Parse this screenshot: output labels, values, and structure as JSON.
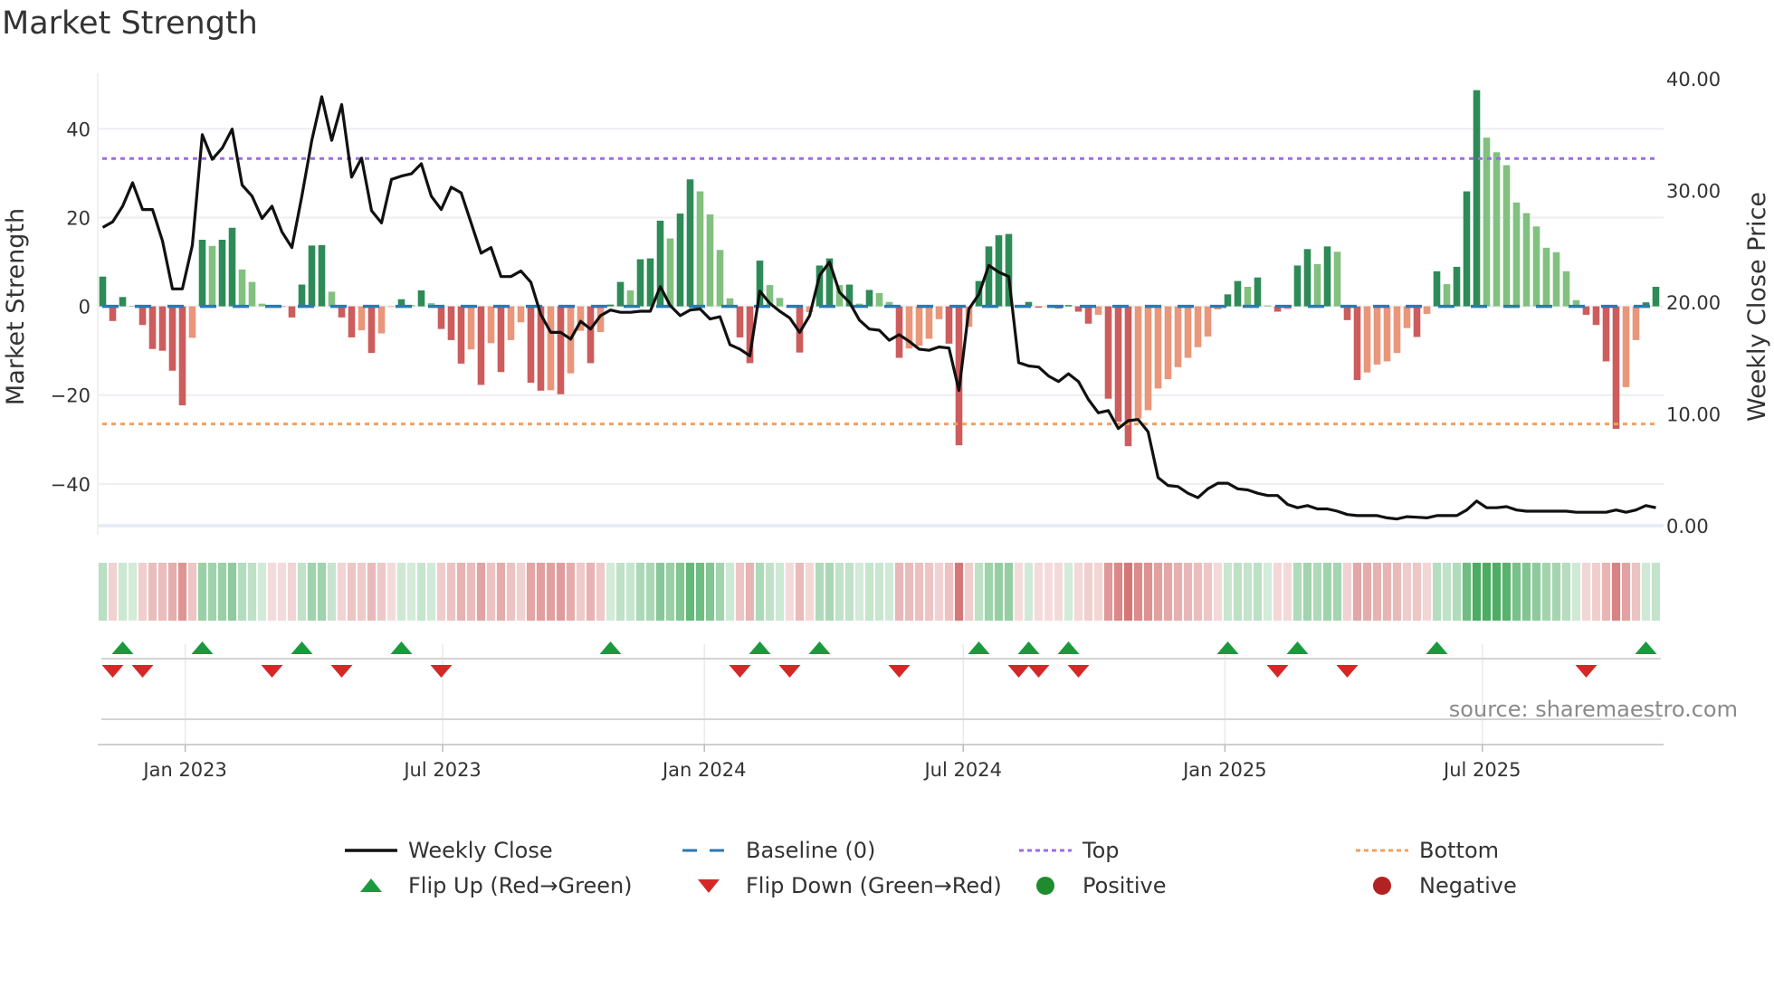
{
  "title": "Market Strength",
  "source": "source: sharemaestro.com",
  "legend": {
    "weekly_close": "Weekly Close",
    "baseline": "Baseline (0)",
    "top": "Top",
    "bottom": "Bottom",
    "flip_up": "Flip Up (Red→Green)",
    "flip_down": "Flip Down (Green→Red)",
    "positive": "Positive",
    "negative": "Negative"
  },
  "colors": {
    "bar_positive_rising": "#2e8b57",
    "bar_positive_falling": "#82c07f",
    "bar_negative_falling": "#cd5c5c",
    "bar_negative_rising": "#e9967a",
    "baseline": "#2a7ab0",
    "top": "#9b6ee0",
    "bottom": "#f2a062",
    "close": "#111111",
    "flip_up": "#1a9a3c",
    "flip_down": "#d62728",
    "positive": "#1e8c2e",
    "negative": "#b22222"
  },
  "chart_data": {
    "type": "bar",
    "title": "Market Strength",
    "ylabel": "Market Strength",
    "y2label": "Weekly Close Price",
    "ylim": [
      -49.4,
      52.5
    ],
    "y2lim": [
      0,
      40.5
    ],
    "yticks": [
      "40",
      "20",
      "0",
      "−20",
      "−40"
    ],
    "ytick_values": [
      40,
      20,
      0,
      -20,
      -40
    ],
    "y2ticks": [
      "40.00",
      "30.00",
      "20.00",
      "10.00",
      "0.00"
    ],
    "y2tick_values": [
      40,
      30,
      20,
      10,
      0
    ],
    "xticks": [
      {
        "label": "Jan 2023",
        "date": "2023-01-01"
      },
      {
        "label": "Jul 2023",
        "date": "2023-07-01"
      },
      {
        "label": "Jan 2024",
        "date": "2024-01-01"
      },
      {
        "label": "Jul 2024",
        "date": "2024-07-01"
      },
      {
        "label": "Jan 2025",
        "date": "2025-01-01"
      },
      {
        "label": "Jul 2025",
        "date": "2025-07-01"
      }
    ],
    "x_start": "2022-11-04",
    "x_frequency": "weekly",
    "grid": true,
    "legend_position": "bottom",
    "top_level": 33.3,
    "bottom_level": -26.5,
    "baseline": 0,
    "strength": [
      6.7,
      -3.3,
      2.1,
      0.1,
      -4.2,
      -9.6,
      -10,
      -14.5,
      -22.3,
      -7.1,
      15,
      13.6,
      15,
      17.7,
      8.3,
      5.5,
      0.6,
      -0.1,
      -0.1,
      -2.5,
      4.9,
      13.7,
      13.8,
      3.3,
      -2.5,
      -7,
      -5.4,
      -10.5,
      -6.1,
      -0.1,
      1.6,
      0.3,
      3.6,
      0.7,
      -5.1,
      -7.6,
      -12.9,
      -9.7,
      -17.7,
      -8.3,
      -14.8,
      -7.6,
      -3.6,
      -17.2,
      -19,
      -18.9,
      -19.8,
      -15.1,
      -5.5,
      -12.8,
      -5.8,
      0.4,
      5.5,
      3.6,
      10.6,
      10.8,
      19.3,
      15.3,
      20.9,
      28.6,
      25.9,
      20.7,
      12.7,
      1.8,
      -7,
      -12.8,
      10.3,
      4.8,
      1.9,
      -0.3,
      -10.4,
      -1.3,
      9.2,
      10.8,
      4.8,
      4.9,
      0.6,
      3.7,
      3.0,
      1.0,
      -11.6,
      -9.5,
      -8.9,
      -7.3,
      -2.9,
      -8.4,
      -31.3,
      -4.6,
      5.7,
      13.5,
      16,
      16.3,
      -0.2,
      1.0,
      -0.3,
      -0.1,
      -0.5,
      0.3,
      -1.2,
      -3.9,
      -1.9,
      -20.8,
      -26.0,
      -31.5,
      -25.3,
      -23.4,
      -18.5,
      -16.4,
      -13.7,
      -11.6,
      -9.2,
      -6.8,
      -0.7,
      2.7,
      5.7,
      4.4,
      6.5,
      0.2,
      -1.2,
      -0.6,
      9.2,
      12.9,
      9.5,
      13.5,
      12.3,
      -3.1,
      -16.6,
      -14.9,
      -13.1,
      -12.4,
      -10.5,
      -4.9,
      -6.9,
      -1.7,
      7.9,
      5.0,
      8.9,
      25.9,
      48.7,
      38,
      34.7,
      31.8,
      23.4,
      21,
      18,
      13.2,
      12.2,
      7.9,
      1.4,
      -1.9,
      -4.2,
      -12.4,
      -27.6,
      -18.2,
      -7.6,
      0.9,
      4.4
    ],
    "weekly_close": [
      26.7,
      27.2,
      28.6,
      30.7,
      28.3,
      28.3,
      25.5,
      21.2,
      21.2,
      25.1,
      35.0,
      32.8,
      33.8,
      35.5,
      30.5,
      29.5,
      27.5,
      28.6,
      26.3,
      24.9,
      29.5,
      34.5,
      38.4,
      34.5,
      37.7,
      31.2,
      32.9,
      28.2,
      27.1,
      31.0,
      31.3,
      31.5,
      32.4,
      29.5,
      28.3,
      30.3,
      29.8,
      27.1,
      24.4,
      24.9,
      22.3,
      22.3,
      22.8,
      21.8,
      18.9,
      17.3,
      17.3,
      16.7,
      18.3,
      17.6,
      18.8,
      19.3,
      19.1,
      19.1,
      19.2,
      19.2,
      21.4,
      19.7,
      18.8,
      19.3,
      19.4,
      18.5,
      18.7,
      16.2,
      15.8,
      15.2,
      21.0,
      19.9,
      19.2,
      18.6,
      17.3,
      18.8,
      22.4,
      23.6,
      20.9,
      20.0,
      18.4,
      17.6,
      17.5,
      16.6,
      17.1,
      16.5,
      15.8,
      15.7,
      16.0,
      15.9,
      12.1,
      19.4,
      20.7,
      23.3,
      22.7,
      22.3,
      14.6,
      14.3,
      14.2,
      13.4,
      12.9,
      13.6,
      12.9,
      11.3,
      10.1,
      10.3,
      8.7,
      9.4,
      9.5,
      8.4,
      4.3,
      3.6,
      3.5,
      2.9,
      2.5,
      3.3,
      3.8,
      3.8,
      3.3,
      3.2,
      2.9,
      2.7,
      2.7,
      1.9,
      1.6,
      1.8,
      1.5,
      1.5,
      1.3,
      1.0,
      0.9,
      0.9,
      0.9,
      0.7,
      0.6,
      0.8,
      0.75,
      0.7,
      0.9,
      0.9,
      0.9,
      1.4,
      2.2,
      1.6,
      1.6,
      1.7,
      1.4,
      1.3,
      1.3,
      1.3,
      1.3,
      1.3,
      1.2,
      1.2,
      1.2,
      1.2,
      1.4,
      1.2,
      1.4,
      1.8,
      1.6
    ]
  }
}
